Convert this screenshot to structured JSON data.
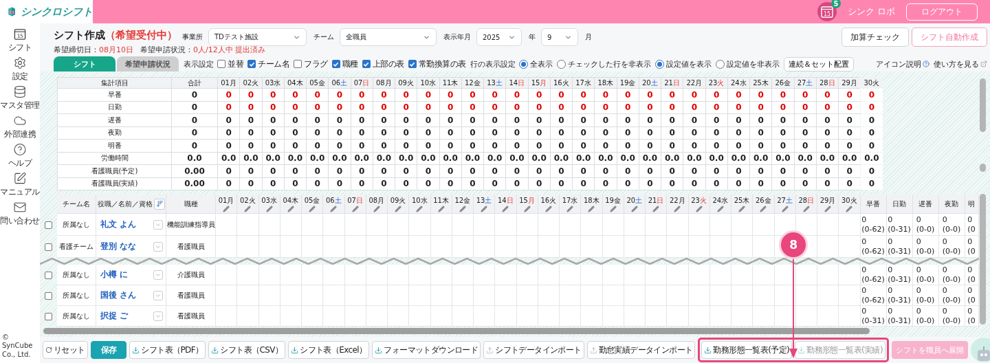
{
  "header": {
    "logo_text": "シンクロシフト",
    "notification": {
      "icon_text": "15",
      "badge": "5"
    },
    "user": "シンク ロボ",
    "logout": "ログアウト"
  },
  "sidebar": {
    "items": [
      {
        "label": "シフト",
        "icon_text": "15"
      },
      {
        "label": "設定"
      },
      {
        "label": "マスタ管理"
      },
      {
        "label": "外部連携"
      },
      {
        "label": "ヘルプ"
      },
      {
        "label": "マニュアル"
      },
      {
        "label": "問い合わせ"
      }
    ],
    "copyright": "© SynCube Co., Ltd."
  },
  "page": {
    "title": "シフト作成",
    "status": "（希望受付中）",
    "deadline": {
      "label": "希望締切日：",
      "value": "08月10日"
    },
    "submission": {
      "label": "希望申請状況：",
      "value": "0人/12人中 提出済み"
    },
    "office": {
      "label": "事業所",
      "value": "TDテスト施設"
    },
    "team": {
      "label": "チーム",
      "value": "全職員"
    },
    "period": {
      "label": "表示年月",
      "year": "2025",
      "year_unit": "年",
      "month": "9",
      "month_unit": "月"
    },
    "actions": [
      {
        "label": "加算チェック",
        "kind": "default"
      },
      {
        "label": "シフト自動作成",
        "kind": "accent"
      }
    ]
  },
  "tabs": [
    {
      "label": "シフト",
      "selected": true
    },
    {
      "label": "希望申請状況",
      "selected": false
    }
  ],
  "display_settings": {
    "label": "表示設定",
    "options": [
      {
        "label": "並替",
        "checked": false
      },
      {
        "label": "チーム名",
        "checked": true
      },
      {
        "label": "フラグ",
        "checked": false
      },
      {
        "label": "職種",
        "checked": true
      },
      {
        "label": "上部の表",
        "checked": true
      },
      {
        "label": "常勤換算の表",
        "checked": true
      }
    ]
  },
  "row_display": {
    "label": "行の表示設定",
    "options": [
      {
        "label": "全表示",
        "selected": true
      },
      {
        "label": "チェックした行を非表示",
        "selected": false
      }
    ]
  },
  "value_display": {
    "options": [
      {
        "label": "設定値を表示",
        "selected": true
      },
      {
        "label": "設定値を非表示",
        "selected": false
      }
    ]
  },
  "placement_button": "連続＆セット配置",
  "help_links": [
    {
      "label": "アイコン説明",
      "kind": "help"
    },
    {
      "label": "使い方を見る",
      "kind": "external"
    }
  ],
  "summary": {
    "columns": [
      "集計項目",
      "合計"
    ],
    "days": [
      {
        "day": "01",
        "weekday": "月",
        "kind": "weekday"
      },
      {
        "day": "02",
        "weekday": "火",
        "kind": "weekday"
      },
      {
        "day": "03",
        "weekday": "水",
        "kind": "weekday"
      },
      {
        "day": "04",
        "weekday": "木",
        "kind": "weekday"
      },
      {
        "day": "05",
        "weekday": "金",
        "kind": "weekday"
      },
      {
        "day": "06",
        "weekday": "土",
        "kind": "saturday"
      },
      {
        "day": "07",
        "weekday": "日",
        "kind": "holiday"
      },
      {
        "day": "08",
        "weekday": "月",
        "kind": "weekday"
      },
      {
        "day": "09",
        "weekday": "火",
        "kind": "weekday"
      },
      {
        "day": "10",
        "weekday": "水",
        "kind": "weekday"
      },
      {
        "day": "11",
        "weekday": "木",
        "kind": "weekday"
      },
      {
        "day": "12",
        "weekday": "金",
        "kind": "weekday"
      },
      {
        "day": "13",
        "weekday": "土",
        "kind": "saturday"
      },
      {
        "day": "14",
        "weekday": "日",
        "kind": "holiday"
      },
      {
        "day": "15",
        "weekday": "月",
        "kind": "holiday"
      },
      {
        "day": "16",
        "weekday": "火",
        "kind": "weekday"
      },
      {
        "day": "17",
        "weekday": "水",
        "kind": "weekday"
      },
      {
        "day": "18",
        "weekday": "木",
        "kind": "weekday"
      },
      {
        "day": "19",
        "weekday": "金",
        "kind": "weekday"
      },
      {
        "day": "20",
        "weekday": "土",
        "kind": "saturday"
      },
      {
        "day": "21",
        "weekday": "日",
        "kind": "holiday"
      },
      {
        "day": "22",
        "weekday": "月",
        "kind": "weekday"
      },
      {
        "day": "23",
        "weekday": "火",
        "kind": "holiday"
      },
      {
        "day": "24",
        "weekday": "水",
        "kind": "weekday"
      },
      {
        "day": "25",
        "weekday": "木",
        "kind": "weekday"
      },
      {
        "day": "26",
        "weekday": "金",
        "kind": "weekday"
      },
      {
        "day": "27",
        "weekday": "土",
        "kind": "saturday"
      },
      {
        "day": "28",
        "weekday": "日",
        "kind": "holiday"
      },
      {
        "day": "29",
        "weekday": "月",
        "kind": "weekday"
      },
      {
        "day": "30",
        "weekday": "火",
        "kind": "weekday"
      }
    ],
    "rows": [
      {
        "label": "早番",
        "total": "0",
        "alert": true,
        "values": [
          "0",
          "0",
          "0",
          "0",
          "0",
          "0",
          "0",
          "0",
          "0",
          "0",
          "0",
          "0",
          "0",
          "0",
          "0",
          "0",
          "0",
          "0",
          "0",
          "0",
          "0",
          "0",
          "0",
          "0",
          "0",
          "0",
          "0",
          "0",
          "0",
          "0"
        ]
      },
      {
        "label": "日勤",
        "total": "0",
        "alert": true,
        "values": [
          "0",
          "0",
          "0",
          "0",
          "0",
          "0",
          "0",
          "0",
          "0",
          "0",
          "0",
          "0",
          "0",
          "0",
          "0",
          "0",
          "0",
          "0",
          "0",
          "0",
          "0",
          "0",
          "0",
          "0",
          "0",
          "0",
          "0",
          "0",
          "0",
          "0"
        ]
      },
      {
        "label": "遅番",
        "total": "0",
        "alert": false,
        "values": [
          "0",
          "0",
          "0",
          "0",
          "0",
          "0",
          "0",
          "0",
          "0",
          "0",
          "0",
          "0",
          "0",
          "0",
          "0",
          "0",
          "0",
          "0",
          "0",
          "0",
          "0",
          "0",
          "0",
          "0",
          "0",
          "0",
          "0",
          "0",
          "0",
          "0"
        ]
      },
      {
        "label": "夜勤",
        "total": "0",
        "alert": false,
        "values": [
          "0",
          "0",
          "0",
          "0",
          "0",
          "0",
          "0",
          "0",
          "0",
          "0",
          "0",
          "0",
          "0",
          "0",
          "0",
          "0",
          "0",
          "0",
          "0",
          "0",
          "0",
          "0",
          "0",
          "0",
          "0",
          "0",
          "0",
          "0",
          "0",
          "0"
        ]
      },
      {
        "label": "明番",
        "total": "0",
        "alert": false,
        "values": [
          "0",
          "0",
          "0",
          "0",
          "0",
          "0",
          "0",
          "0",
          "0",
          "0",
          "0",
          "0",
          "0",
          "0",
          "0",
          "0",
          "0",
          "0",
          "0",
          "0",
          "0",
          "0",
          "0",
          "0",
          "0",
          "0",
          "0",
          "0",
          "0",
          "0"
        ]
      },
      {
        "label": "労働時間",
        "total": "0.0",
        "alert": false,
        "values": [
          "0.0",
          "0.0",
          "0.0",
          "0.0",
          "0.0",
          "0.0",
          "0.0",
          "0.0",
          "0.0",
          "0.0",
          "0.0",
          "0.0",
          "0.0",
          "0.0",
          "0.0",
          "0.0",
          "0.0",
          "0.0",
          "0.0",
          "0.0",
          "0.0",
          "0.0",
          "0.0",
          "0.0",
          "0.0",
          "0.0",
          "0.0",
          "0.0",
          "0.0",
          "0.0"
        ]
      },
      {
        "label": "看護職員(予定)",
        "total": "0.00",
        "alert": false,
        "values": [
          "0",
          "0",
          "0",
          "0",
          "0",
          "0",
          "0",
          "0",
          "0",
          "0",
          "0",
          "0",
          "0",
          "0",
          "0",
          "0",
          "0",
          "0",
          "0",
          "0",
          "0",
          "0",
          "0",
          "0",
          "0",
          "0",
          "0",
          "0",
          "0",
          "0"
        ]
      },
      {
        "label": "看護職員(実績)",
        "total": "0.00",
        "alert": false,
        "values": [
          "0",
          "0",
          "0",
          "0",
          "0",
          "0",
          "0",
          "0",
          "0",
          "0",
          "0",
          "0",
          "0",
          "0",
          "0",
          "0",
          "0",
          "0",
          "0",
          "0",
          "0",
          "0",
          "0",
          "0",
          "0",
          "0",
          "0",
          "0",
          "0",
          "0"
        ]
      }
    ]
  },
  "staff": {
    "columns": [
      "チーム名",
      "役職／名前／資格",
      "職種"
    ],
    "days": [
      {
        "day": "01",
        "weekday": "月",
        "kind": "weekday"
      },
      {
        "day": "02",
        "weekday": "火",
        "kind": "weekday"
      },
      {
        "day": "03",
        "weekday": "水",
        "kind": "weekday"
      },
      {
        "day": "04",
        "weekday": "木",
        "kind": "weekday"
      },
      {
        "day": "05",
        "weekday": "金",
        "kind": "weekday"
      },
      {
        "day": "06",
        "weekday": "土",
        "kind": "saturday"
      },
      {
        "day": "07",
        "weekday": "日",
        "kind": "holiday"
      },
      {
        "day": "08",
        "weekday": "月",
        "kind": "weekday"
      },
      {
        "day": "09",
        "weekday": "火",
        "kind": "weekday"
      },
      {
        "day": "10",
        "weekday": "水",
        "kind": "weekday"
      },
      {
        "day": "11",
        "weekday": "木",
        "kind": "weekday"
      },
      {
        "day": "12",
        "weekday": "金",
        "kind": "weekday"
      },
      {
        "day": "13",
        "weekday": "土",
        "kind": "saturday"
      },
      {
        "day": "14",
        "weekday": "日",
        "kind": "holiday"
      },
      {
        "day": "15",
        "weekday": "月",
        "kind": "holiday"
      },
      {
        "day": "16",
        "weekday": "火",
        "kind": "weekday"
      },
      {
        "day": "17",
        "weekday": "水",
        "kind": "weekday"
      },
      {
        "day": "18",
        "weekday": "木",
        "kind": "weekday"
      },
      {
        "day": "19",
        "weekday": "金",
        "kind": "weekday"
      },
      {
        "day": "20",
        "weekday": "土",
        "kind": "saturday"
      },
      {
        "day": "21",
        "weekday": "日",
        "kind": "holiday"
      },
      {
        "day": "22",
        "weekday": "月",
        "kind": "weekday"
      },
      {
        "day": "23",
        "weekday": "火",
        "kind": "holiday"
      },
      {
        "day": "24",
        "weekday": "水",
        "kind": "weekday"
      },
      {
        "day": "25",
        "weekday": "木",
        "kind": "weekday"
      },
      {
        "day": "26",
        "weekday": "金",
        "kind": "weekday"
      },
      {
        "day": "27",
        "weekday": "土",
        "kind": "saturday"
      },
      {
        "day": "28",
        "weekday": "日",
        "kind": "holiday"
      },
      {
        "day": "29",
        "weekday": "月",
        "kind": "weekday"
      },
      {
        "day": "30",
        "weekday": "火",
        "kind": "weekday"
      }
    ],
    "stat_columns": [
      "早番",
      "日勤",
      "遅番",
      "夜勤",
      "明"
    ],
    "rows": [
      {
        "checked": false,
        "team": "所属なし",
        "name": "礼文 よん",
        "job": "機能訓練指導員",
        "stats": [
          {
            "value": "0",
            "range": "(0-62)"
          },
          {
            "value": "0",
            "range": "(0-31)"
          },
          {
            "value": "0",
            "range": "(0-0)"
          },
          {
            "value": "0",
            "range": "(0-0)"
          },
          {
            "value": "0",
            "range": "(0"
          }
        ]
      },
      {
        "checked": false,
        "team": "看護チーム",
        "name": "登別 なな",
        "job": "看護職員",
        "stats": [
          {
            "value": "0",
            "range": "(0-62)"
          },
          {
            "value": "0",
            "range": "(0-31)"
          },
          {
            "value": "0",
            "range": "(0-0)"
          },
          {
            "value": "0",
            "range": "(0-0)"
          },
          {
            "value": "0",
            "range": "(0"
          }
        ]
      },
      {
        "checked": false,
        "team": "所属なし",
        "name": "小樽 に",
        "job": "介護職員",
        "stats": [
          {
            "value": "0",
            "range": "(0-62)"
          },
          {
            "value": "0",
            "range": "(0-31)"
          },
          {
            "value": "0",
            "range": "(0-0)"
          },
          {
            "value": "0",
            "range": "(0-0)"
          },
          {
            "value": "0",
            "range": "(0"
          }
        ]
      },
      {
        "checked": false,
        "team": "所属なし",
        "name": "国後 さん",
        "job": "看護職員",
        "stats": [
          {
            "value": "0",
            "range": "(0-62)"
          },
          {
            "value": "0",
            "range": "(0-31)"
          },
          {
            "value": "0",
            "range": "(0-0)"
          },
          {
            "value": "0",
            "range": "(0-0)"
          },
          {
            "value": "0",
            "range": "(0"
          }
        ]
      },
      {
        "checked": false,
        "team": "所属なし",
        "name": "択捉 ご",
        "job": "看護職員",
        "stats": [
          {
            "value": "0",
            "range": "(0-31)"
          },
          {
            "value": "0",
            "range": "(0-31)"
          },
          {
            "value": "0",
            "range": "(0-0)"
          },
          {
            "value": "0",
            "range": "(0-0)"
          },
          {
            "value": "0",
            "range": "(0"
          }
        ]
      }
    ]
  },
  "bottom": {
    "buttons": [
      {
        "label": "リセット",
        "kind": "reset",
        "disabled": false
      },
      {
        "label": "保存",
        "kind": "primary",
        "disabled": false
      },
      {
        "label": "シフト表（PDF）",
        "kind": "download",
        "disabled": false
      },
      {
        "label": "シフト表（CSV）",
        "kind": "download",
        "disabled": false
      },
      {
        "label": "シフト表（Excel）",
        "kind": "download",
        "disabled": false
      },
      {
        "label": "フォーマットダウンロード",
        "kind": "download",
        "disabled": false
      },
      {
        "label": "シフトデータインポート",
        "kind": "upload",
        "disabled": false
      },
      {
        "label": "勤怠実績データインポート",
        "kind": "upload",
        "disabled": false
      },
      {
        "label": "勤務形態一覧表(予定)",
        "kind": "download",
        "disabled": false,
        "highlighted": true
      },
      {
        "label": "勤務形態一覧表(実績)",
        "kind": "download",
        "disabled": true,
        "highlighted": true
      }
    ],
    "deploy": {
      "label": "シフトを職員へ展開",
      "disabled": true
    },
    "annotation": {
      "step": "8"
    }
  }
}
